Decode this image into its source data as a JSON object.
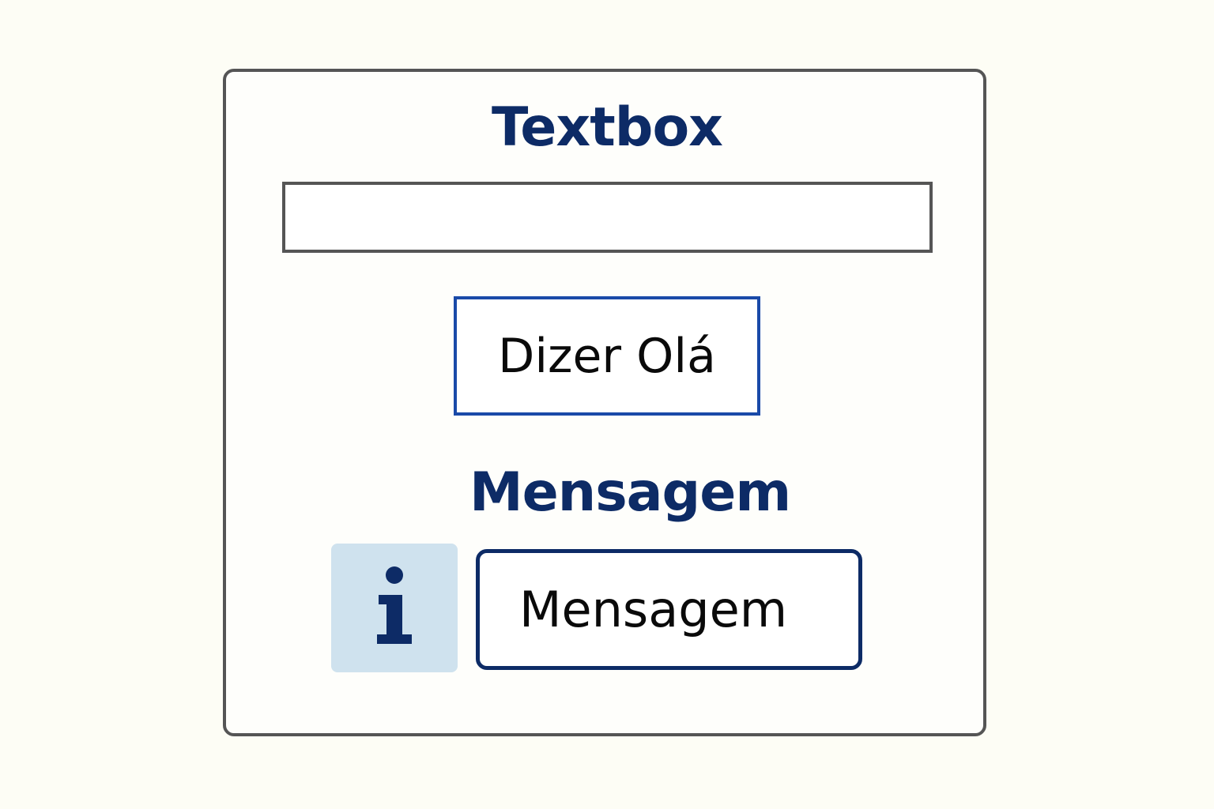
{
  "colors": {
    "heading": "#0d2b66",
    "info_tile_bg": "#cfe2ee",
    "info_icon": "#0d2b66",
    "button_border": "#1a4aa8"
  },
  "title": "Textbox",
  "textbox": {
    "value": "",
    "placeholder": ""
  },
  "button": {
    "label": "Dizer Olá"
  },
  "message": {
    "heading": "Mensagem",
    "icon": "info-icon",
    "text": "Mensagem"
  }
}
